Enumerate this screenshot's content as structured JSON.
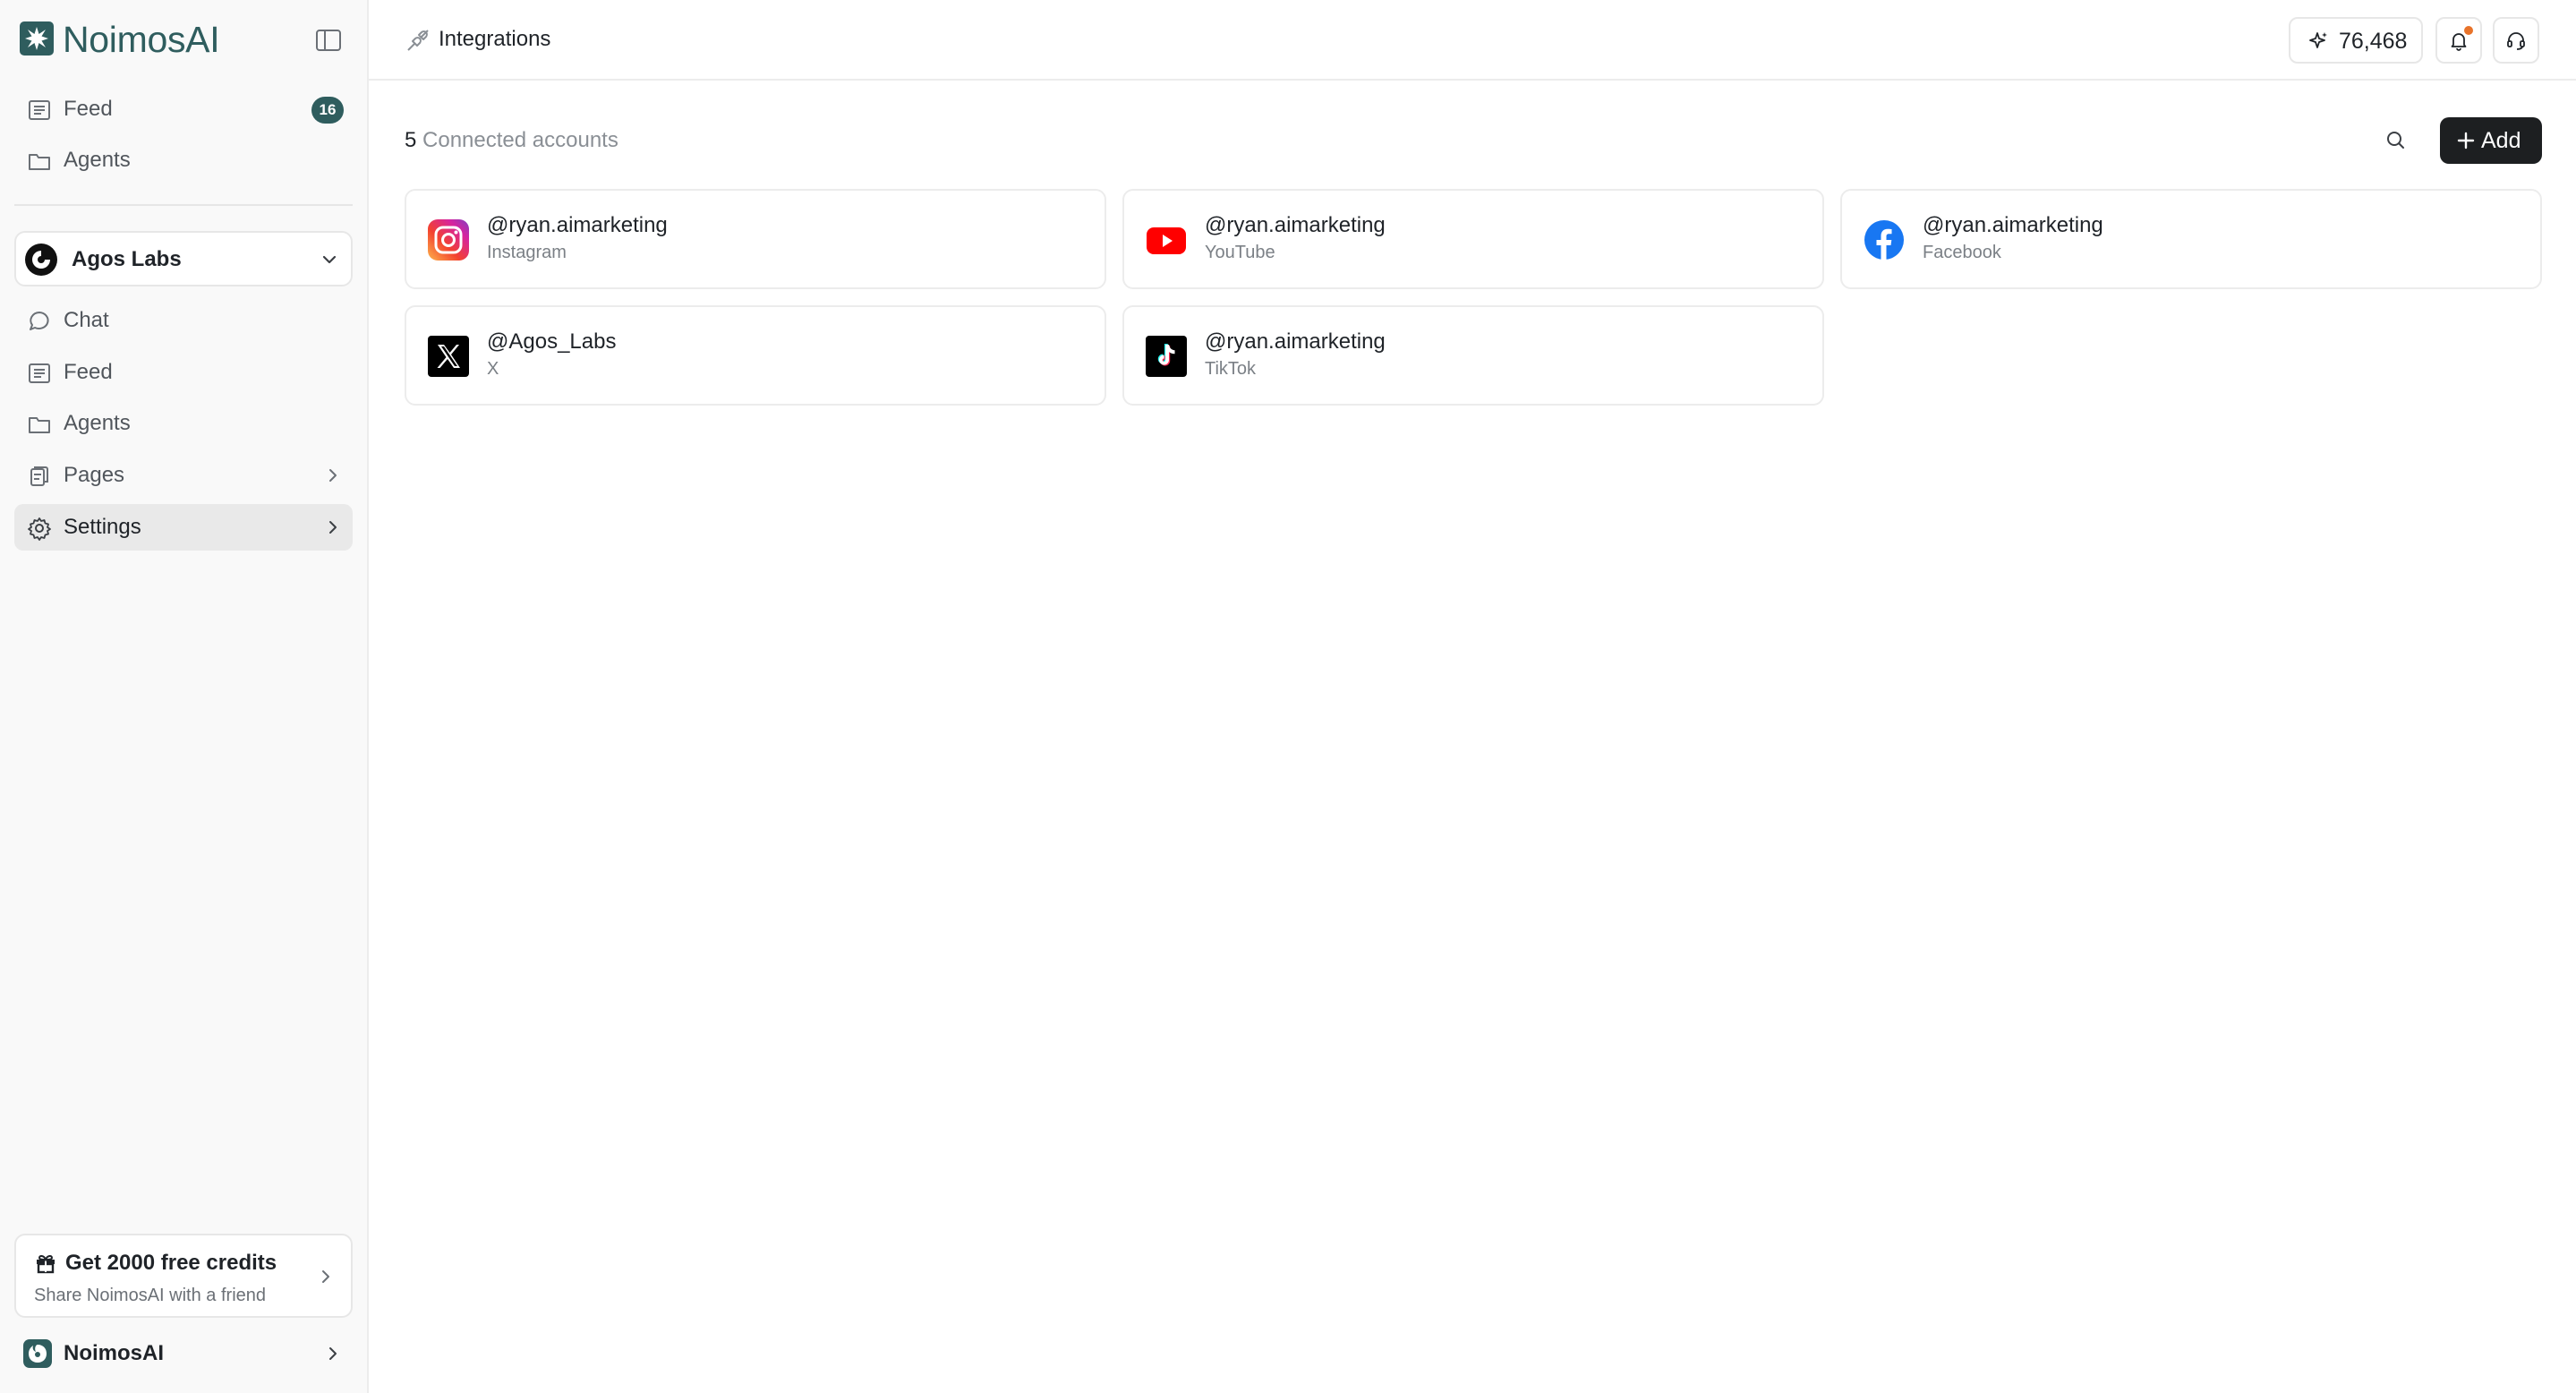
{
  "brand": {
    "name": "NoimosAI"
  },
  "sidebar": {
    "top_items": [
      {
        "label": "Feed",
        "icon": "list-icon",
        "badge": "16"
      },
      {
        "label": "Agents",
        "icon": "folder-icon"
      }
    ],
    "workspace": {
      "name": "Agos Labs"
    },
    "items": [
      {
        "label": "Chat",
        "icon": "chat-bubble-icon"
      },
      {
        "label": "Feed",
        "icon": "list-icon"
      },
      {
        "label": "Agents",
        "icon": "folder-icon"
      },
      {
        "label": "Pages",
        "icon": "pages-icon"
      },
      {
        "label": "Settings",
        "icon": "gear-icon",
        "active": true
      }
    ],
    "promo": {
      "title": "Get 2000 free credits",
      "subtitle": "Share NoimosAI with a friend"
    },
    "org": {
      "name": "NoimosAI"
    }
  },
  "header": {
    "breadcrumb": "Integrations",
    "credits": "76,468"
  },
  "main": {
    "count_number": "5",
    "count_label": "Connected accounts",
    "add_label": "Add",
    "accounts": [
      {
        "handle": "@ryan.aimarketing",
        "platform": "Instagram",
        "icon": "instagram-icon"
      },
      {
        "handle": "@ryan.aimarketing",
        "platform": "YouTube",
        "icon": "youtube-icon"
      },
      {
        "handle": "@ryan.aimarketing",
        "platform": "Facebook",
        "icon": "facebook-icon"
      },
      {
        "handle": "@Agos_Labs",
        "platform": "X",
        "icon": "x-icon"
      },
      {
        "handle": "@ryan.aimarketing",
        "platform": "TikTok",
        "icon": "tiktok-icon"
      }
    ]
  },
  "colors": {
    "brand": "#2f5d5e",
    "accent_dark": "#1d1f21",
    "notification_dot": "#e8732a"
  }
}
